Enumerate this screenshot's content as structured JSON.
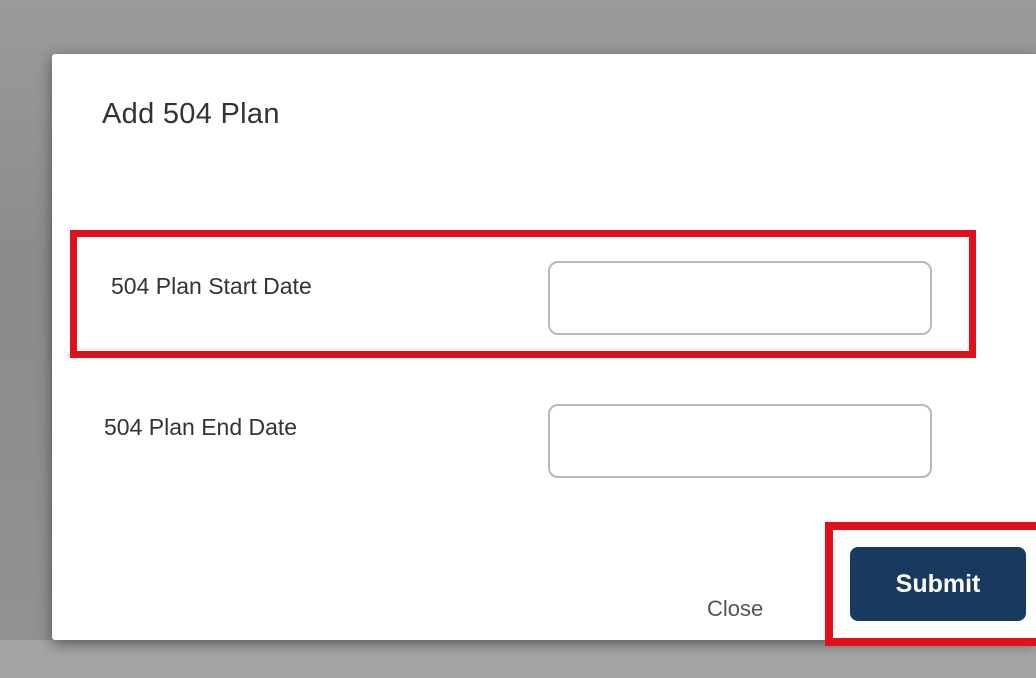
{
  "dialog": {
    "title": "Add 504 Plan",
    "fields": [
      {
        "label": "504 Plan Start Date",
        "value": ""
      },
      {
        "label": "504 Plan End Date",
        "value": ""
      }
    ],
    "footer": {
      "close_label": "Close",
      "submit_label": "Submit"
    }
  },
  "colors": {
    "highlight": "#e0101c",
    "submit_background": "#173a5e",
    "overlay": "#8e8e8e"
  }
}
